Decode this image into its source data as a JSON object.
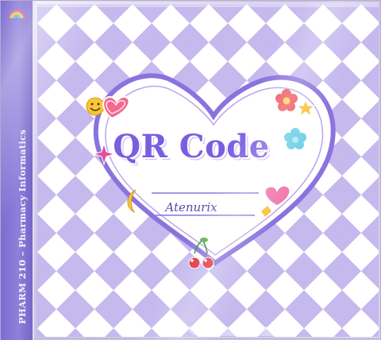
{
  "spine": {
    "text": "PHARM 210 – Pharmacy Informatics",
    "icon": "rainbow-icon"
  },
  "cover": {
    "title": "QR Code",
    "author": "Atenurix",
    "stickers": [
      "smiley-icon",
      "heart-icon",
      "flower-icon",
      "star-icon",
      "moon-icon",
      "cherries-icon",
      "sparkle-icon"
    ]
  },
  "colors": {
    "accent": "#7a5ee0",
    "gingham": "#8b73de",
    "spine": "#7c6cd0"
  }
}
